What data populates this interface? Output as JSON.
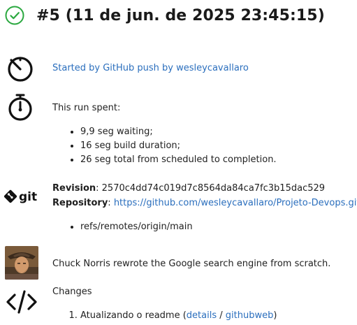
{
  "header": {
    "title": "#5 (11 de jun. de 2025 23:45:15)",
    "status_color": "#2aa83f"
  },
  "trigger": {
    "icon": "timer-icon",
    "text": "Started by GitHub push by wesleycavallaro"
  },
  "timing": {
    "icon": "stopwatch-icon",
    "intro": "This run spent:",
    "items": [
      "9,9 seg waiting;",
      "16 seg build duration;",
      "26 seg total from scheduled to completion."
    ]
  },
  "git": {
    "icon": "git-logo",
    "revision_label": "Revision",
    "revision_value": ": 2570c4dd74c019d7c8564da84ca7fc3b15dac529",
    "repository_label": "Repository",
    "repository_sep": ": ",
    "repository_url": "https://github.com/wesleycavallaro/Projeto-Devops.git",
    "refs": [
      "refs/remotes/origin/main"
    ]
  },
  "fact": {
    "avatar": "chuck-norris-avatar",
    "text": "Chuck Norris rewrote the Google search engine from scratch."
  },
  "changes": {
    "icon": "code-icon",
    "title": "Changes",
    "items": [
      {
        "text": "Atualizando o readme (",
        "details": "details",
        "sep": " / ",
        "githubweb": "githubweb",
        "end": ")"
      }
    ]
  },
  "colors": {
    "link": "#2a6ebd",
    "text": "#1f1f1f",
    "success": "#2aa83f"
  }
}
